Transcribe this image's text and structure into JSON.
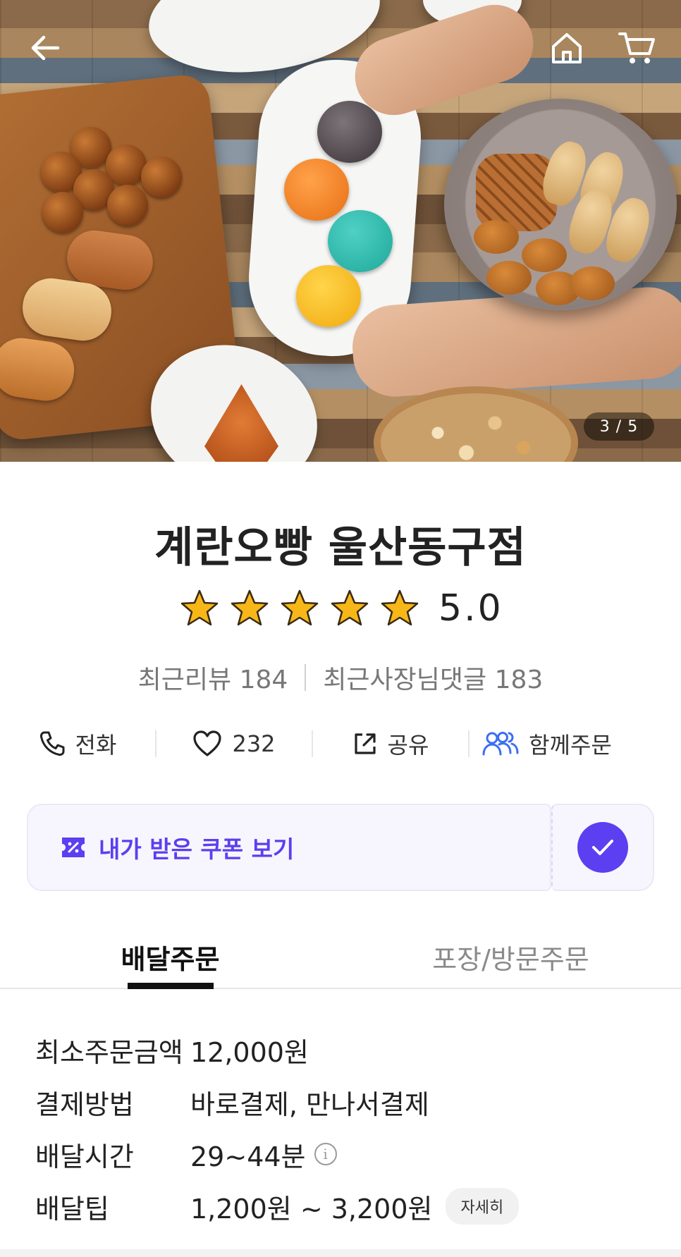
{
  "hero": {
    "page_counter": "3 / 5",
    "back_icon": "back-arrow-icon",
    "home_icon": "home-icon",
    "cart_icon": "cart-icon"
  },
  "store": {
    "name": "계란오빵 울산동구점",
    "rating": "5.0",
    "star_count": 5,
    "recent_reviews": "최근리뷰 184",
    "recent_owner_replies": "최근사장님댓글 183"
  },
  "actions": {
    "call_label": "전화",
    "like_count": "232",
    "share_label": "공유",
    "group_order_label": "함께주문"
  },
  "coupon": {
    "label": "내가 받은 쿠폰 보기"
  },
  "tabs": [
    {
      "label": "배달주문"
    },
    {
      "label": "포장/방문주문"
    }
  ],
  "info": {
    "rows": [
      {
        "label": "최소주문금액",
        "value": "12,000원"
      },
      {
        "label": "결제방법",
        "value": "바로결제, 만나서결제"
      },
      {
        "label": "배달시간",
        "value": "29~44분"
      },
      {
        "label": "배달팁",
        "value": "1,200원 ~ 3,200원"
      }
    ],
    "detail_button": "자세히"
  },
  "colors": {
    "accent": "#5b3ff0",
    "star": "#f7b719",
    "group_icon": "#3b6ef5"
  }
}
